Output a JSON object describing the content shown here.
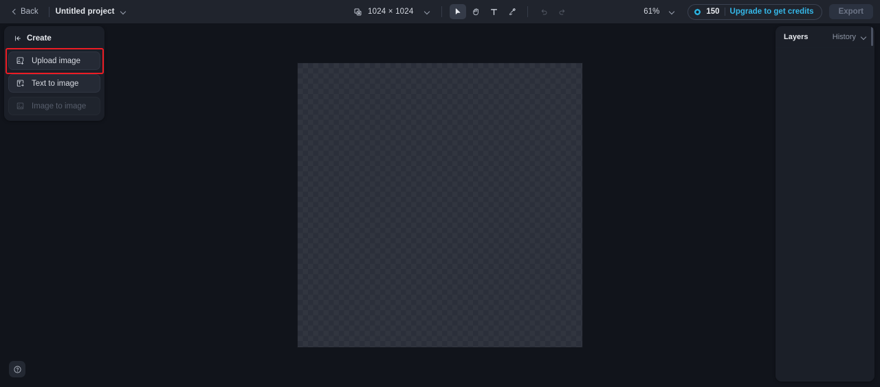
{
  "topbar": {
    "back_label": "Back",
    "back_icon": "chevron-left-icon",
    "project_name": "Untitled project",
    "project_caret_icon": "chevron-down-icon",
    "canvas_size": "1024 × 1024",
    "canvas_size_icon": "canvas-resize-icon",
    "canvas_size_caret_icon": "chevron-down-icon",
    "tools": [
      {
        "name": "select-tool",
        "icon": "cursor-arrow-icon",
        "active": true
      },
      {
        "name": "hand-tool",
        "icon": "hand-icon",
        "active": false
      },
      {
        "name": "text-tool",
        "icon": "text-t-icon",
        "active": false
      },
      {
        "name": "brush-tool",
        "icon": "paintbrush-icon",
        "active": false
      }
    ],
    "history_tools": [
      {
        "name": "undo-button",
        "icon": "undo-arrow-icon",
        "disabled": true
      },
      {
        "name": "redo-button",
        "icon": "redo-arrow-icon",
        "disabled": true
      }
    ],
    "zoom_level": "61%",
    "zoom_caret_icon": "chevron-down-icon",
    "credits_icon": "credit-coin-icon",
    "credits_count": "150",
    "upgrade_label": "Upgrade to get credits",
    "export_label": "Export"
  },
  "left_panel": {
    "header_label": "Create",
    "collapse_icon": "collapse-panel-left-icon",
    "items": [
      {
        "label": "Upload image",
        "icon": "upload-image-icon",
        "disabled": false,
        "highlighted": true
      },
      {
        "label": "Text to image",
        "icon": "text-to-image-icon",
        "disabled": false,
        "highlighted": false
      },
      {
        "label": "Image to image",
        "icon": "image-to-image-icon",
        "disabled": true,
        "highlighted": false
      }
    ]
  },
  "canvas": {
    "artboard_label": "transparent-artboard",
    "help_icon": "help-question-icon"
  },
  "right_panel": {
    "layers_tab": "Layers",
    "history_tab": "History",
    "history_caret_icon": "chevron-down-icon"
  },
  "colors": {
    "app_background": "#0e1117",
    "topbar_background": "#20242d",
    "panel_background": "#1b1f28",
    "canvas_background": "#11141b",
    "accent_link": "#35b7e8",
    "annotation_highlight": "#ed1c24",
    "artboard_checker_a": "#2b2f3a",
    "artboard_checker_b": "#31353f"
  }
}
